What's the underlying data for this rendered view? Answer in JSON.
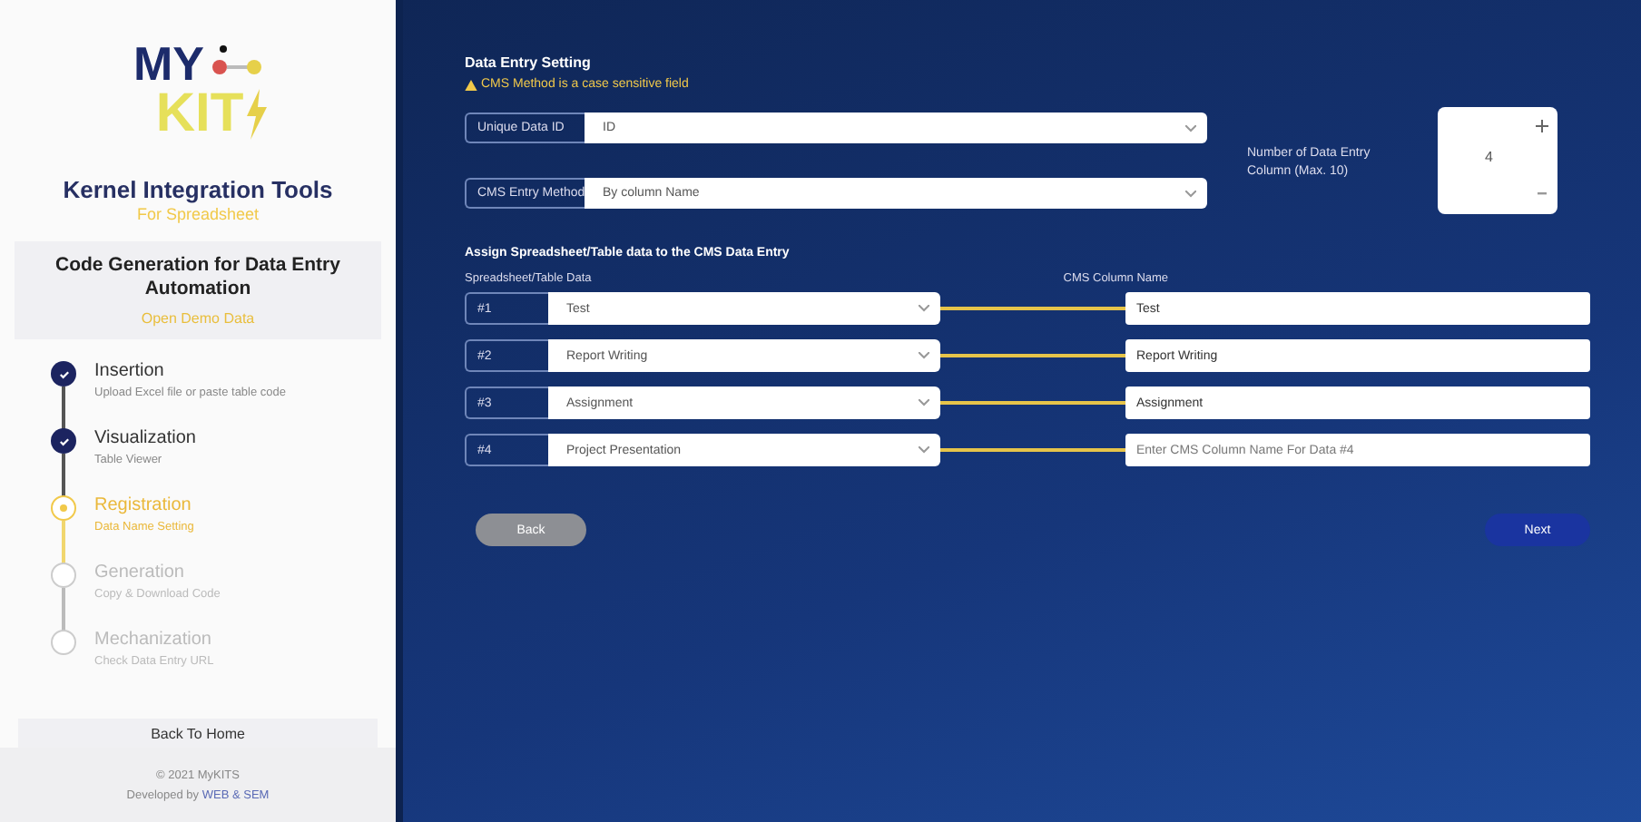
{
  "sidebar": {
    "logo": {
      "top": "MY",
      "bottom": "KIT"
    },
    "title": "Kernel Integration Tools",
    "subtitle": "For Spreadsheet",
    "card": {
      "title": "Code Generation for Data Entry Automation",
      "link": "Open Demo Data"
    },
    "steps": [
      {
        "label": "Insertion",
        "detail": "Upload Excel file or paste table code",
        "kind": "done"
      },
      {
        "label": "Visualization",
        "detail": "Table Viewer",
        "kind": "done"
      },
      {
        "label": "Registration",
        "detail": "Data Name Setting",
        "kind": "current"
      },
      {
        "label": "Generation",
        "detail": "Copy & Download Code",
        "kind": "pending"
      },
      {
        "label": "Mechanization",
        "detail": "Check Data Entry URL",
        "kind": "pending"
      }
    ],
    "home_button": "Back To Home",
    "footer": {
      "copyright": "© 2021 MyKITS",
      "credit": "Developed by **WEB & SEM**"
    }
  },
  "main": {
    "title": "Data Entry Setting",
    "warning": "CMS Method is a case sensitive field",
    "settings": [
      {
        "label": "Unique Data ID",
        "value": "ID"
      },
      {
        "label": "CMS Entry Method",
        "value": "By column Name"
      }
    ],
    "count": {
      "label": "Number of Data Entry Column (Max. 10)",
      "value": "4"
    },
    "assign_title": "Assign Spreadsheet/Table data to the CMS Data Entry",
    "left_header": "Spreadsheet/Table Data",
    "right_header": "CMS Column Name",
    "rows": [
      {
        "index": "#1",
        "source": "Test",
        "target": "Test"
      },
      {
        "index": "#2",
        "source": "Report Writing",
        "target": "Report Writing"
      },
      {
        "index": "#3",
        "source": "Assignment",
        "target": "Assignment"
      },
      {
        "index": "#4",
        "source": "Project Presentation",
        "placeholder": "Enter CMS Column Name For Data #4"
      }
    ],
    "buttons": {
      "back": "Back",
      "next": "Next"
    }
  }
}
